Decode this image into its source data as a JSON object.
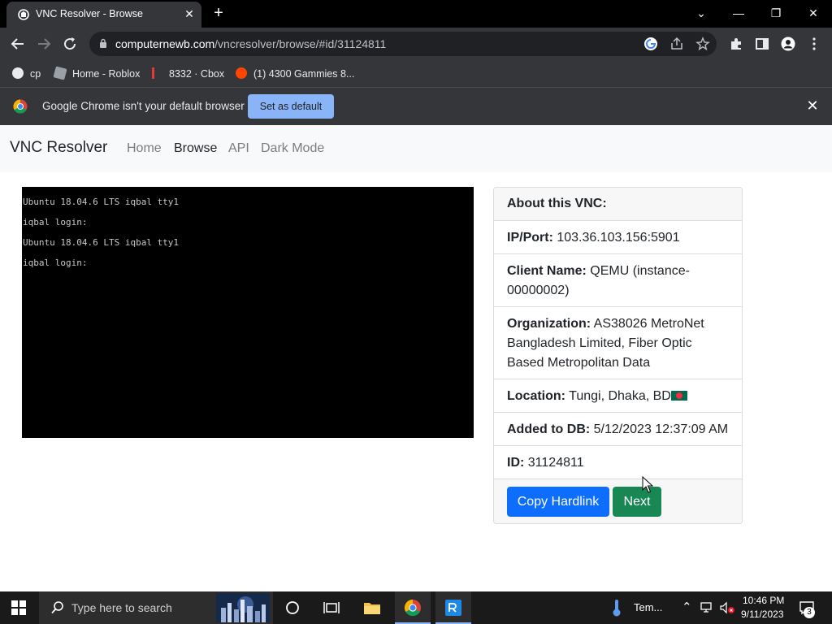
{
  "browser": {
    "tab_title": "VNC Resolver - Browse",
    "tab_close": "✕",
    "new_tab": "+",
    "window_controls": {
      "dropdown": "⌄",
      "minimize": "—",
      "maximize": "❐",
      "close": "✕"
    },
    "url_domain": "computernewb.com",
    "url_path": "/vncresolver/browse/#id/31124811",
    "bookmarks": [
      {
        "label": "cp"
      },
      {
        "label": "Home - Roblox"
      },
      {
        "label": "8332 · Cbox"
      },
      {
        "label": "(1) 4300 Gammies 8..."
      }
    ],
    "infobar": {
      "message": "Google Chrome isn't your default browser",
      "button": "Set as default",
      "close": "✕"
    }
  },
  "site": {
    "brand": "VNC Resolver",
    "nav": [
      {
        "label": "Home",
        "active": false
      },
      {
        "label": "Browse",
        "active": true
      },
      {
        "label": "API",
        "active": false
      },
      {
        "label": "Dark Mode",
        "active": false
      }
    ]
  },
  "screen_lines": [
    "Ubuntu 18.04.6 LTS iqbal tty1",
    "iqbal login:",
    "Ubuntu 18.04.6 LTS iqbal tty1",
    "iqbal login:"
  ],
  "about": {
    "header": "About this VNC:",
    "ip_label": "IP/Port:",
    "ip_value": "103.36.103.156:5901",
    "client_label": "Client Name:",
    "client_value": "QEMU (instance-00000002)",
    "org_label": "Organization:",
    "org_value": "AS38026 MetroNet Bangladesh Limited, Fiber Optic Based Metropolitan Data",
    "location_label": "Location:",
    "location_value": "Tungi, Dhaka, BD",
    "added_label": "Added to DB:",
    "added_value": "5/12/2023 12:37:09 AM",
    "id_label": "ID:",
    "id_value": "31124811",
    "copy_button": "Copy Hardlink",
    "next_button": "Next"
  },
  "taskbar": {
    "search_placeholder": "Type here to search",
    "weather": "Tem...",
    "time": "10:46 PM",
    "date": "9/11/2023",
    "notifications": "3"
  },
  "colors": {
    "primary": "#0d6efd",
    "success": "#198754",
    "chrome_dark": "#35363a",
    "infobar_button": "#8ab4f8"
  }
}
